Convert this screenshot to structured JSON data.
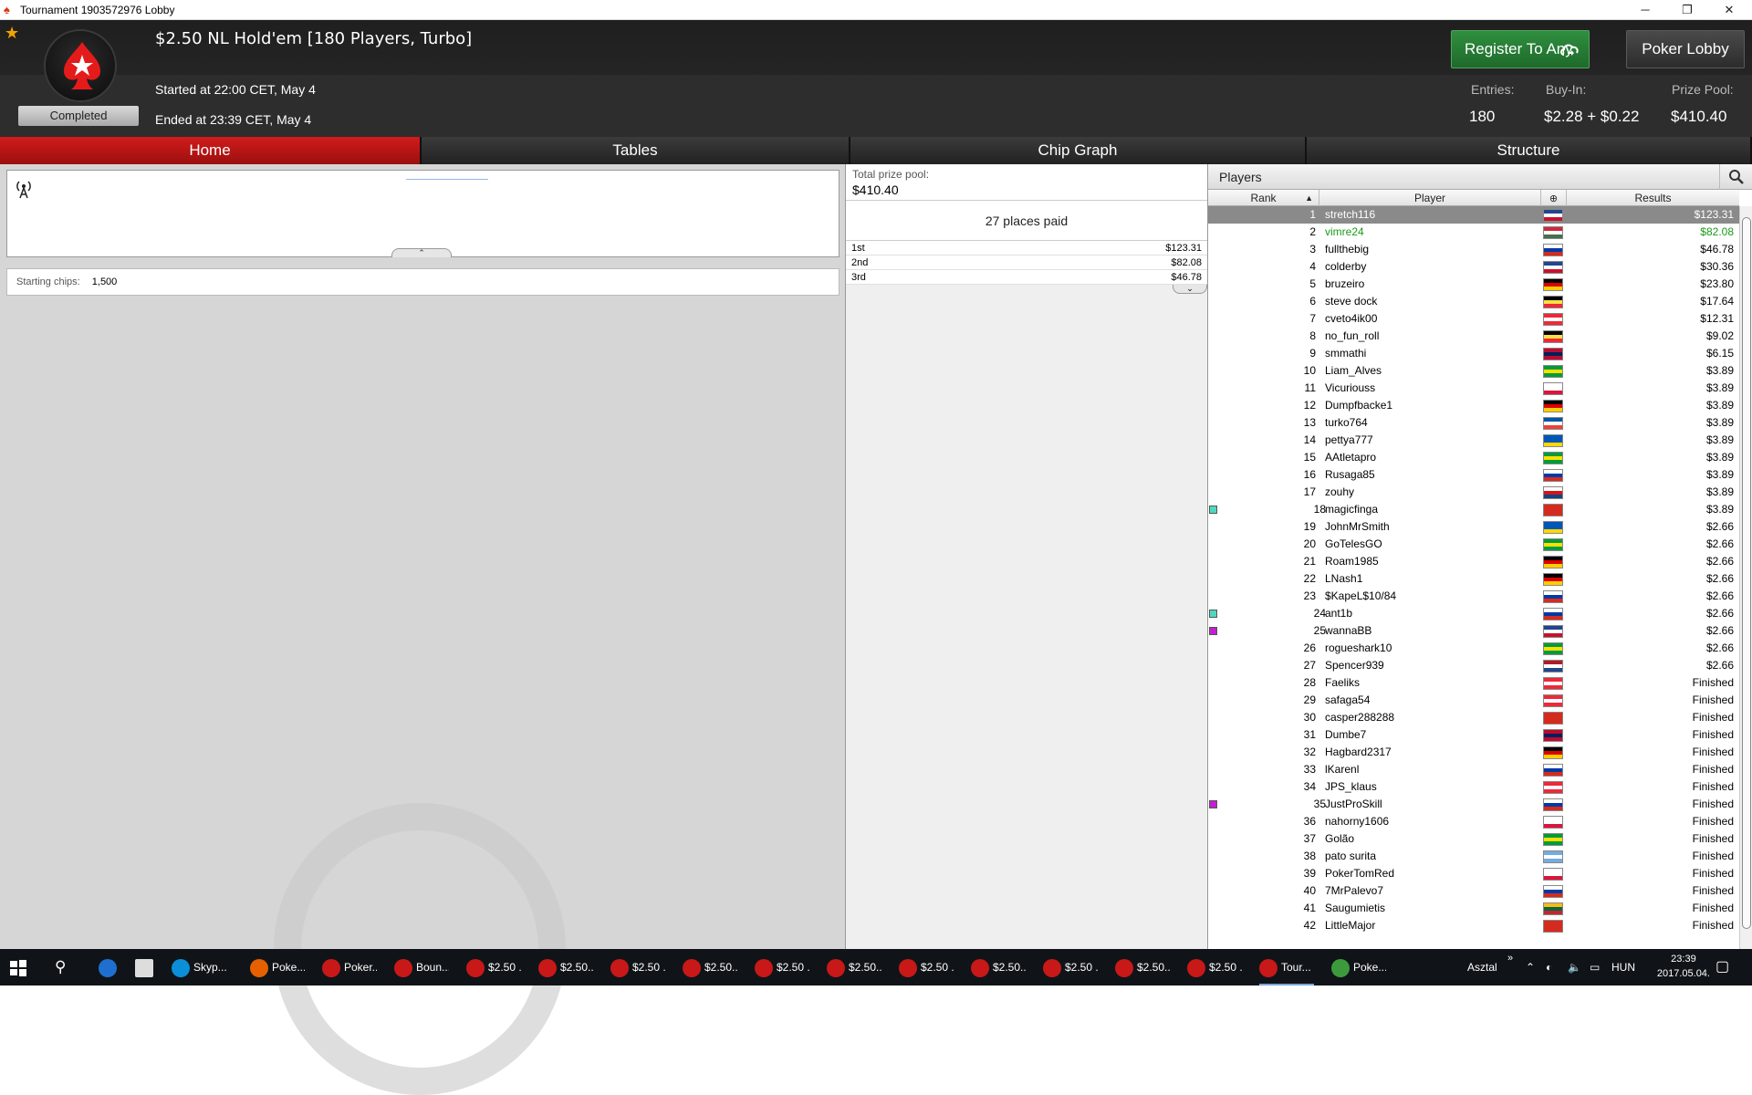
{
  "window": {
    "title": "Tournament 1903572976 Lobby",
    "min": "─",
    "max": "❐",
    "close": "✕"
  },
  "header": {
    "title": "$2.50 NL Hold'em [180 Players, Turbo]",
    "status": "Completed",
    "started": "Started at 22:00 CET, May 4",
    "ended": "Ended at 23:39 CET, May 4",
    "register_label": "Register To Any",
    "lobby_label": "Poker Lobby",
    "stats": {
      "entries_label": "Entries:",
      "entries": "180",
      "buyin_label": "Buy-In:",
      "buyin": "$2.28 + $0.22",
      "pool_label": "Prize Pool:",
      "pool": "$410.40"
    }
  },
  "tabs": [
    {
      "label": "Home"
    },
    {
      "label": "Tables"
    },
    {
      "label": "Chip Graph"
    },
    {
      "label": "Structure"
    }
  ],
  "home": {
    "chips_label": "Starting chips:",
    "chips_value": "1,500"
  },
  "prize": {
    "total_label": "Total prize pool:",
    "total": "$410.40",
    "places": "27 places paid",
    "payouts": [
      {
        "place": "1st",
        "amount": "$123.31"
      },
      {
        "place": "2nd",
        "amount": "$82.08"
      },
      {
        "place": "3rd",
        "amount": "$46.78"
      }
    ]
  },
  "players": {
    "title": "Players",
    "columns": {
      "rank": "Rank",
      "player": "Player",
      "results": "Results"
    },
    "rows": [
      {
        "rank": "1",
        "name": "stretch116",
        "result": "$123.31",
        "flag": "uk",
        "sel": true
      },
      {
        "rank": "2",
        "name": "vimre24",
        "result": "$82.08",
        "flag": "hu",
        "green": true
      },
      {
        "rank": "3",
        "name": "fullthebig",
        "result": "$46.78",
        "flag": "ru"
      },
      {
        "rank": "4",
        "name": "colderby",
        "result": "$30.36",
        "flag": "uk"
      },
      {
        "rank": "5",
        "name": "bruzeiro",
        "result": "$23.80",
        "flag": "de"
      },
      {
        "rank": "6",
        "name": "steve dock",
        "result": "$17.64",
        "flag": "be"
      },
      {
        "rank": "7",
        "name": "cveto4ik00",
        "result": "$12.31",
        "flag": "at"
      },
      {
        "rank": "8",
        "name": "no_fun_roll",
        "result": "$9.02",
        "flag": "be"
      },
      {
        "rank": "9",
        "name": "smmathi",
        "result": "$6.15",
        "flag": "no"
      },
      {
        "rank": "10",
        "name": "Liam_Alves",
        "result": "$3.89",
        "flag": "br"
      },
      {
        "rank": "11",
        "name": "Vicuriouss",
        "result": "$3.89",
        "flag": "pl"
      },
      {
        "rank": "12",
        "name": "Dumpfbacke1",
        "result": "$3.89",
        "flag": "de"
      },
      {
        "rank": "13",
        "name": "turko764",
        "result": "$3.89",
        "flag": "fr"
      },
      {
        "rank": "14",
        "name": "pettya777",
        "result": "$3.89",
        "flag": "ua"
      },
      {
        "rank": "15",
        "name": "AAtletapro",
        "result": "$3.89",
        "flag": "br"
      },
      {
        "rank": "16",
        "name": "Rusaga85",
        "result": "$3.89",
        "flag": "ru"
      },
      {
        "rank": "17",
        "name": "zouhy",
        "result": "$3.89",
        "flag": "cz"
      },
      {
        "rank": "18",
        "name": "magicfinga",
        "result": "$3.89",
        "flag": "ch",
        "mark": "#4ed8c0"
      },
      {
        "rank": "19",
        "name": "JohnMrSmith",
        "result": "$2.66",
        "flag": "ua"
      },
      {
        "rank": "20",
        "name": "GoTelesGO",
        "result": "$2.66",
        "flag": "br"
      },
      {
        "rank": "21",
        "name": "Roam1985",
        "result": "$2.66",
        "flag": "de"
      },
      {
        "rank": "22",
        "name": "LNash1",
        "result": "$2.66",
        "flag": "de"
      },
      {
        "rank": "23",
        "name": "$KapeL$10/84",
        "result": "$2.66",
        "flag": "ru"
      },
      {
        "rank": "24",
        "name": "ant1b",
        "result": "$2.66",
        "flag": "ru",
        "mark": "#4ed8c0"
      },
      {
        "rank": "25",
        "name": "wannaBB",
        "result": "$2.66",
        "flag": "uk",
        "mark": "#c020d0"
      },
      {
        "rank": "26",
        "name": "rogueshark10",
        "result": "$2.66",
        "flag": "br"
      },
      {
        "rank": "27",
        "name": "Spencer939",
        "result": "$2.66",
        "flag": "nl"
      },
      {
        "rank": "28",
        "name": "Faeliks",
        "result": "Finished",
        "flag": "at"
      },
      {
        "rank": "29",
        "name": "safaga54",
        "result": "Finished",
        "flag": "at"
      },
      {
        "rank": "30",
        "name": "casper288288",
        "result": "Finished",
        "flag": "ch"
      },
      {
        "rank": "31",
        "name": "Dumbe7",
        "result": "Finished",
        "flag": "no"
      },
      {
        "rank": "32",
        "name": "Hagbard2317",
        "result": "Finished",
        "flag": "de"
      },
      {
        "rank": "33",
        "name": "lKarenl",
        "result": "Finished",
        "flag": "ru"
      },
      {
        "rank": "34",
        "name": "JPS_klaus",
        "result": "Finished",
        "flag": "at"
      },
      {
        "rank": "35",
        "name": "JustProSkill",
        "result": "Finished",
        "flag": "ru",
        "mark": "#c020d0"
      },
      {
        "rank": "36",
        "name": "nahorny1606",
        "result": "Finished",
        "flag": "pl"
      },
      {
        "rank": "37",
        "name": "Golão",
        "result": "Finished",
        "flag": "br"
      },
      {
        "rank": "38",
        "name": "pato surita",
        "result": "Finished",
        "flag": "ar"
      },
      {
        "rank": "39",
        "name": "PokerTomRed",
        "result": "Finished",
        "flag": "pl"
      },
      {
        "rank": "40",
        "name": "7MrPalevo7",
        "result": "Finished",
        "flag": "ru"
      },
      {
        "rank": "41",
        "name": "Saugumietis",
        "result": "Finished",
        "flag": "lt"
      },
      {
        "rank": "42",
        "name": "LittleMajor",
        "result": "Finished",
        "flag": "ch"
      }
    ]
  },
  "taskbar": {
    "items": [
      {
        "label": "Skyp...",
        "icon": "skype-icon",
        "color": "#0a8fd8"
      },
      {
        "label": "Poke...",
        "icon": "firefox-icon",
        "color": "#e66000"
      },
      {
        "label": "Poker...",
        "icon": "pokerstars-icon",
        "color": "#c81818"
      },
      {
        "label": "Boun...",
        "icon": "pokerstars-icon",
        "color": "#c81818"
      },
      {
        "label": "$2.50 ...",
        "icon": "pokerstars-icon",
        "color": "#c81818"
      },
      {
        "label": "$2.50...",
        "icon": "pokerstars-icon",
        "color": "#c81818"
      },
      {
        "label": "$2.50 ...",
        "icon": "pokerstars-icon",
        "color": "#c81818"
      },
      {
        "label": "$2.50...",
        "icon": "pokerstars-icon",
        "color": "#c81818"
      },
      {
        "label": "$2.50 ...",
        "icon": "pokerstars-icon",
        "color": "#c81818"
      },
      {
        "label": "$2.50...",
        "icon": "pokerstars-icon",
        "color": "#c81818"
      },
      {
        "label": "$2.50 ...",
        "icon": "pokerstars-icon",
        "color": "#c81818"
      },
      {
        "label": "$2.50...",
        "icon": "pokerstars-icon",
        "color": "#c81818"
      },
      {
        "label": "$2.50 ...",
        "icon": "pokerstars-icon",
        "color": "#c81818"
      },
      {
        "label": "$2.50...",
        "icon": "pokerstars-icon",
        "color": "#c81818"
      },
      {
        "label": "$2.50 ...",
        "icon": "pokerstars-icon",
        "color": "#c81818"
      },
      {
        "label": "Tour...",
        "icon": "pokerstars-icon",
        "color": "#c81818",
        "active": true
      },
      {
        "label": "Poke...",
        "icon": "holdem-manager-icon",
        "color": "#3c9a3c"
      }
    ],
    "desktop": "Asztal",
    "chevron": "»",
    "lang": "HUN",
    "time": "23:39",
    "date": "2017.05.04."
  }
}
